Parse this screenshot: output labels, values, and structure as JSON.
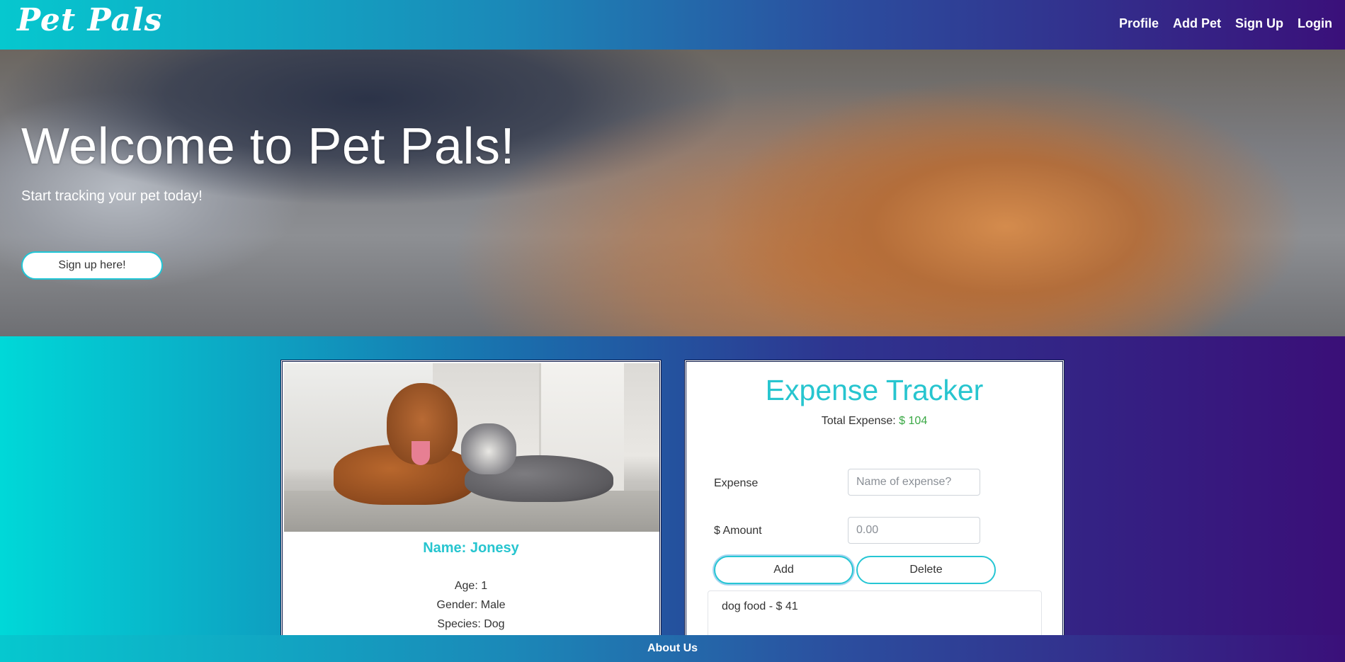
{
  "navbar": {
    "brand": "Pet Pals",
    "links": [
      "Profile",
      "Add Pet",
      "Sign Up",
      "Login"
    ]
  },
  "hero": {
    "title": "Welcome to Pet Pals!",
    "subtitle": "Start tracking your pet today!",
    "button_label": "Sign up here!"
  },
  "pet": {
    "name": "Name: Jonesy",
    "age": "Age: 1",
    "gender": "Gender: Male",
    "species": "Species: Dog"
  },
  "expenses": {
    "title": "Expense Tracker",
    "total_label": "Total Expense:",
    "total_value": "$ 104",
    "expense_label": "Expense",
    "expense_placeholder": "Name of expense?",
    "amount_label": "$ Amount",
    "amount_placeholder": "0.00",
    "add_label": "Add",
    "delete_label": "Delete",
    "items": [
      "dog food - $ 41"
    ]
  },
  "footer": {
    "about_label": "About Us"
  },
  "colors": {
    "accent": "#27c5cf",
    "total_green": "#3aa845",
    "gradient_start": "#00d8d8",
    "gradient_end": "#3a0f78"
  }
}
